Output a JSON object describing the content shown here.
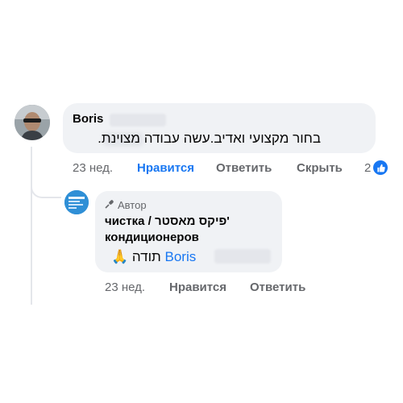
{
  "comment": {
    "author": "Boris",
    "text": "בחור מקצועי ואדיב.עשה עבודה מצוינת.",
    "time": "23 нед.",
    "like_label": "Нравится",
    "reply_label": "Ответить",
    "hide_label": "Скрыть",
    "reaction_count": "2",
    "reaction_icon": "thumbs-up-icon",
    "like_color": "#1877f2"
  },
  "reply": {
    "badge": "Автор",
    "badge_icon": "microphone-icon",
    "name_line1": "чистка / פיקס מאסטר'",
    "name_line2": "кондиционеров",
    "emoji": "🙏",
    "text_word": "תודה",
    "mention": "Boris",
    "time": "23 нед.",
    "like_label": "Нравится",
    "reply_label": "Ответить"
  }
}
